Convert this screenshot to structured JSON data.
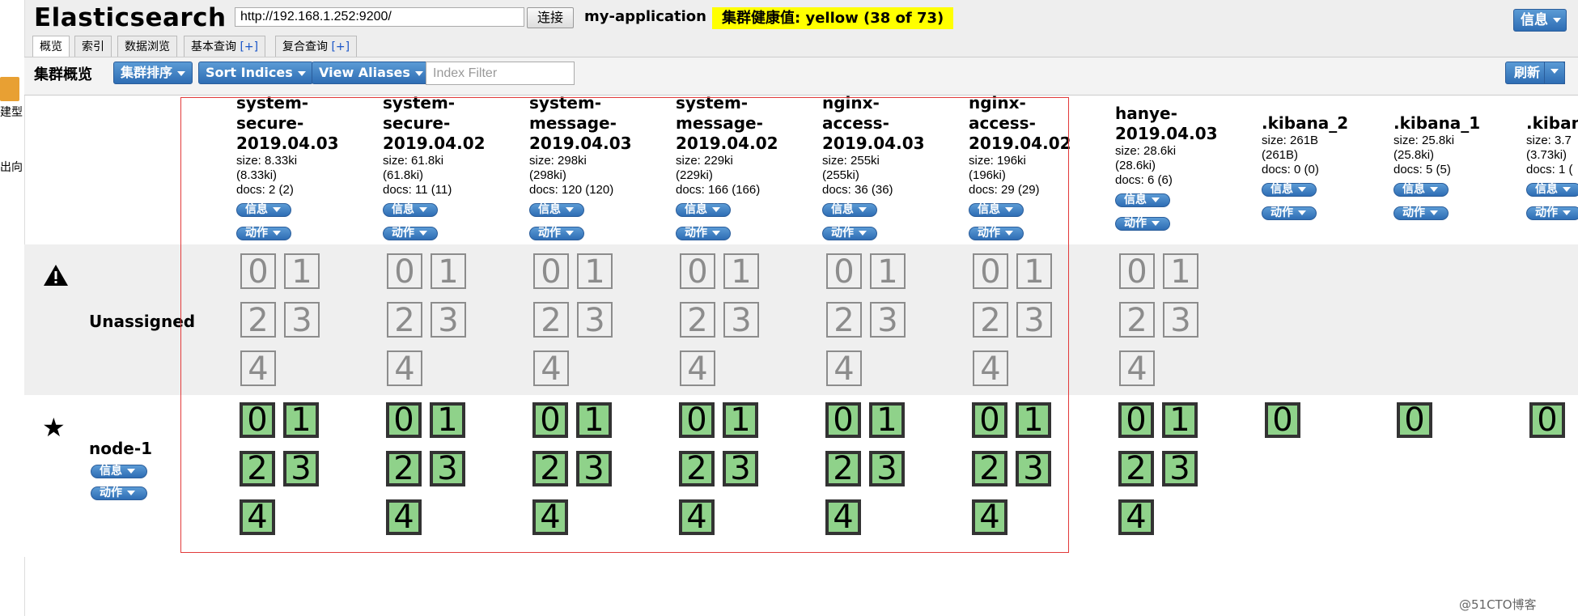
{
  "app_title": "Elasticsearch",
  "connection": {
    "url": "http://192.168.1.252:9200/",
    "connect_label": "连接"
  },
  "cluster": {
    "name": "my-application",
    "health": "集群健康值: yellow (38 of 73)"
  },
  "info_menu_label": "信息",
  "tabs": [
    {
      "label": "概览",
      "plus": ""
    },
    {
      "label": "索引",
      "plus": ""
    },
    {
      "label": "数据浏览",
      "plus": ""
    },
    {
      "label": "基本查询 ",
      "plus": "[+]"
    },
    {
      "label": "复合查询 ",
      "plus": "[+]"
    }
  ],
  "toolbar": {
    "overview_label": "集群概览",
    "sort_cluster": "集群排序",
    "sort_indices": "Sort Indices",
    "view_aliases": "View Aliases",
    "index_filter_placeholder": "Index Filter",
    "refresh": "刷新"
  },
  "side_clip": {
    "top": "建型",
    "bottom": "出向"
  },
  "pill_labels": {
    "info": "信息",
    "action": "动作"
  },
  "rows": {
    "unassigned": "Unassigned",
    "node": "node-1"
  },
  "indices": [
    {
      "name_lines": [
        "system-",
        "secure-",
        "2019.04.03"
      ],
      "size": "size: 8.33ki",
      "size2": "(8.33ki)",
      "docs": "docs: 2 (2)",
      "unassigned": [
        "0",
        "1",
        "2",
        "3",
        "4"
      ],
      "assigned": [
        "0",
        "1",
        "2",
        "3",
        "4"
      ]
    },
    {
      "name_lines": [
        "system-",
        "secure-",
        "2019.04.02"
      ],
      "size": "size: 61.8ki",
      "size2": "(61.8ki)",
      "docs": "docs: 11 (11)",
      "unassigned": [
        "0",
        "1",
        "2",
        "3",
        "4"
      ],
      "assigned": [
        "0",
        "1",
        "2",
        "3",
        "4"
      ]
    },
    {
      "name_lines": [
        "system-",
        "message-",
        "2019.04.03"
      ],
      "size": "size: 298ki",
      "size2": "(298ki)",
      "docs": "docs: 120 (120)",
      "unassigned": [
        "0",
        "1",
        "2",
        "3",
        "4"
      ],
      "assigned": [
        "0",
        "1",
        "2",
        "3",
        "4"
      ]
    },
    {
      "name_lines": [
        "system-",
        "message-",
        "2019.04.02"
      ],
      "size": "size: 229ki",
      "size2": "(229ki)",
      "docs": "docs: 166 (166)",
      "unassigned": [
        "0",
        "1",
        "2",
        "3",
        "4"
      ],
      "assigned": [
        "0",
        "1",
        "2",
        "3",
        "4"
      ]
    },
    {
      "name_lines": [
        "nginx-",
        "access-",
        "2019.04.03"
      ],
      "size": "size: 255ki",
      "size2": "(255ki)",
      "docs": "docs: 36 (36)",
      "unassigned": [
        "0",
        "1",
        "2",
        "3",
        "4"
      ],
      "assigned": [
        "0",
        "1",
        "2",
        "3",
        "4"
      ]
    },
    {
      "name_lines": [
        "nginx-",
        "access-",
        "2019.04.02"
      ],
      "size": "size: 196ki",
      "size2": "(196ki)",
      "docs": "docs: 29 (29)",
      "unassigned": [
        "0",
        "1",
        "2",
        "3",
        "4"
      ],
      "assigned": [
        "0",
        "1",
        "2",
        "3",
        "4"
      ]
    },
    {
      "name_lines": [
        "hanye-",
        "2019.04.03"
      ],
      "size": "size: 28.6ki",
      "size2": "(28.6ki)",
      "docs": "docs: 6 (6)",
      "unassigned": [
        "0",
        "1",
        "2",
        "3",
        "4"
      ],
      "assigned": [
        "0",
        "1",
        "2",
        "3",
        "4"
      ]
    },
    {
      "name_lines": [
        ".kibana_2"
      ],
      "size": "size: 261B",
      "size2": "(261B)",
      "docs": "docs: 0 (0)",
      "unassigned": [],
      "assigned": [
        "0"
      ]
    },
    {
      "name_lines": [
        ".kibana_1"
      ],
      "size": "size: 25.8ki",
      "size2": "(25.8ki)",
      "docs": "docs: 5 (5)",
      "unassigned": [],
      "assigned": [
        "0"
      ]
    },
    {
      "name_lines": [
        ".kiban"
      ],
      "size": "size: 3.7",
      "size2": "(3.73ki)",
      "docs": "docs: 1 (",
      "unassigned": [],
      "assigned": [
        "0"
      ]
    }
  ],
  "watermark": "@51CTO博客"
}
